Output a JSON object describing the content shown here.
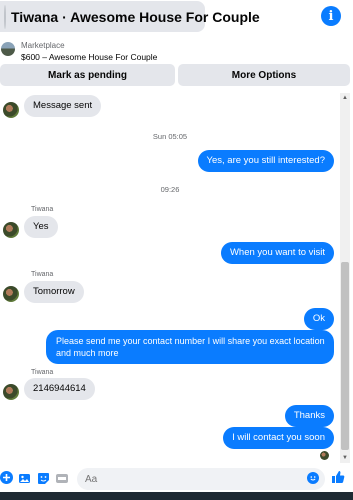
{
  "header": {
    "title": "Tiwana · Awesome House For Couple",
    "info_symbol": "i"
  },
  "listing": {
    "source": "Marketplace",
    "description": "$600 – Awesome House For Couple"
  },
  "actions": {
    "mark_pending": "Mark as pending",
    "more_options": "More Options"
  },
  "thread": {
    "m1": "Message sent",
    "ts1": "Sun 05:05",
    "m2": "Yes, are you still interested?",
    "ts2": "09:26",
    "sender1": "Tiwana",
    "m3": "Yes",
    "m4": "When you want to visit",
    "sender2": "Tiwana",
    "m5": "Tomorrow",
    "m6": "Ok",
    "m7_line1": "Please send me your contact number I will share you exact location",
    "m7_line2": "and much more",
    "sender3": "Tiwana",
    "m8": "2146944614",
    "m9": "Thanks",
    "m10": "I will contact you soon"
  },
  "composer": {
    "placeholder": "Aa"
  },
  "colors": {
    "accent": "#0a7cff",
    "bubble_in": "#e4e6eb"
  },
  "icons": [
    "plus-icon",
    "photo-icon",
    "sticker-icon",
    "gif-icon",
    "emoji-icon",
    "thumbs-up-icon",
    "info-icon"
  ]
}
